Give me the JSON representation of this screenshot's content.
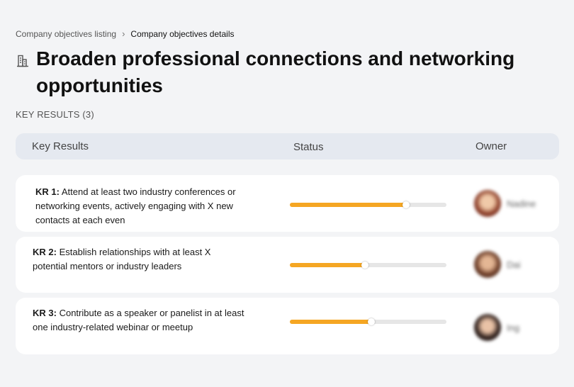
{
  "breadcrumb": {
    "parent": "Company objectives listing",
    "separator": "›",
    "current": "Company objectives details"
  },
  "objective": {
    "icon": "building-icon",
    "title": "Broaden professional connections and networking opportunities"
  },
  "key_results_label": "KEY RESULTS (3)",
  "table": {
    "columns": [
      "Key Results",
      "Status",
      "Owner"
    ],
    "rows": [
      {
        "kr_label": "KR 1:",
        "description": "Attend at least two industry conferences or networking events, actively engaging with X new contacts at each even",
        "progress": 0.74,
        "owner": "Nadine"
      },
      {
        "kr_label": "KR 2:",
        "description": "Establish relationships with at least X potential mentors or industry leaders",
        "progress": 0.48,
        "owner": "Dai"
      },
      {
        "kr_label": "KR 3:",
        "description": "Contribute as a speaker or panelist in at least one industry-related webinar or meetup",
        "progress": 0.52,
        "owner": "Ing"
      }
    ]
  },
  "colors": {
    "progress_fill": "#f5a623",
    "progress_track": "#e6e6e6",
    "header_bg": "#e5e9f0",
    "page_bg": "#f3f4f6"
  }
}
